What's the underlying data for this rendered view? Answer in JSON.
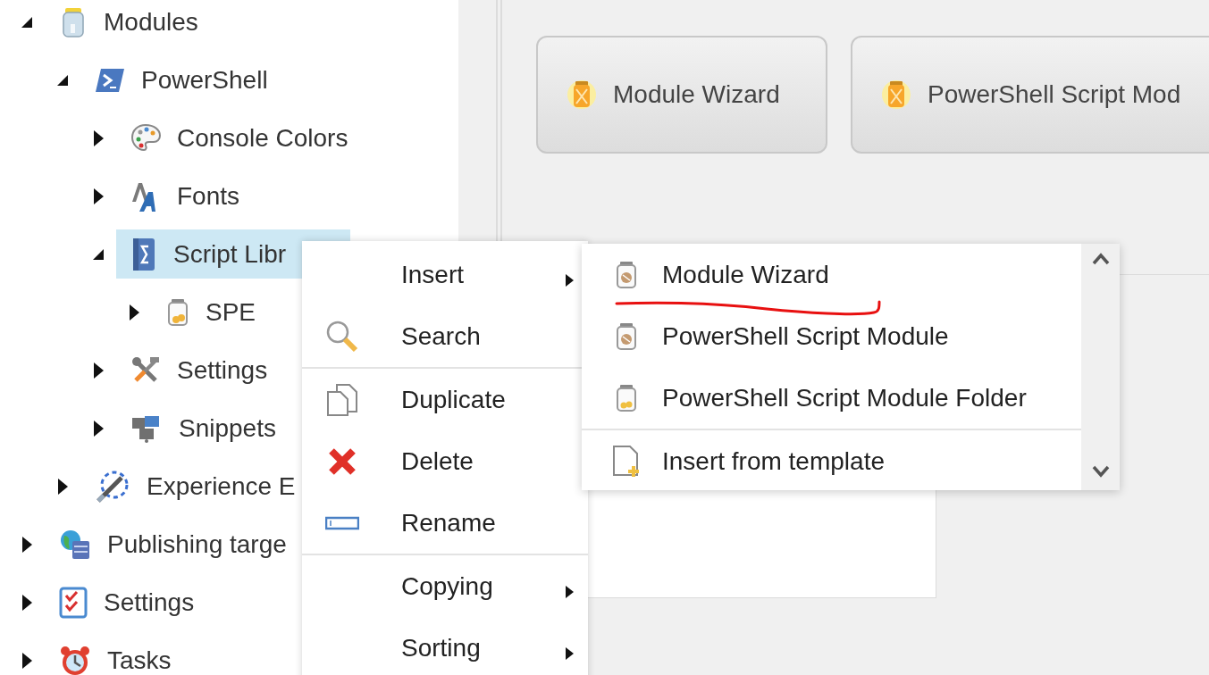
{
  "tree": [
    {
      "label": "Modules",
      "kind": "modules-jar",
      "expanded": true,
      "selected": false,
      "children": [
        {
          "label": "PowerShell",
          "kind": "powershell",
          "expanded": true,
          "selected": false,
          "children": [
            {
              "label": "Console Colors",
              "kind": "palette",
              "expanded": false,
              "selected": false
            },
            {
              "label": "Fonts",
              "kind": "fonts",
              "expanded": false,
              "selected": false
            },
            {
              "label": "Script Libr",
              "kind": "script-book",
              "expanded": true,
              "selected": true,
              "children": [
                {
                  "label": "SPE",
                  "kind": "spe-jar",
                  "expanded": false,
                  "selected": false
                }
              ]
            },
            {
              "label": "Settings",
              "kind": "tools",
              "expanded": false,
              "selected": false
            },
            {
              "label": "Snippets",
              "kind": "puzzle",
              "expanded": false,
              "selected": false
            }
          ]
        },
        {
          "label": "Experience E",
          "kind": "explorer",
          "expanded": false,
          "selected": false
        }
      ]
    },
    {
      "label": "Publishing targe",
      "kind": "publishing",
      "expanded": false,
      "selected": false
    },
    {
      "label": "Settings",
      "kind": "checklist",
      "expanded": false,
      "selected": false
    },
    {
      "label": "Tasks",
      "kind": "alarm",
      "expanded": false,
      "selected": false
    }
  ],
  "insert_options": {
    "buttons": [
      {
        "label": "Module Wizard"
      },
      {
        "label": "PowerShell Script Mod"
      }
    ]
  },
  "context_menu": {
    "groups": [
      {
        "items": [
          {
            "label": "Insert",
            "kind": "none",
            "submenu": true
          },
          {
            "label": "Search",
            "kind": "search",
            "submenu": false
          }
        ]
      },
      {
        "items": [
          {
            "label": "Duplicate",
            "kind": "duplicate",
            "submenu": false
          },
          {
            "label": "Delete",
            "kind": "delete",
            "submenu": false
          },
          {
            "label": "Rename",
            "kind": "rename",
            "submenu": false
          }
        ]
      },
      {
        "items": [
          {
            "label": "Copying",
            "kind": "none",
            "submenu": true
          },
          {
            "label": "Sorting",
            "kind": "none",
            "submenu": true
          }
        ]
      }
    ]
  },
  "insert_submenu": {
    "groups": [
      {
        "items": [
          {
            "label": "Module Wizard",
            "kind": "wizard-jar"
          },
          {
            "label": "PowerShell Script Module",
            "kind": "module-jar"
          },
          {
            "label": "PowerShell Script Module Folder",
            "kind": "folder-jar"
          }
        ]
      },
      {
        "items": [
          {
            "label": "Insert from template",
            "kind": "template"
          }
        ]
      }
    ]
  }
}
